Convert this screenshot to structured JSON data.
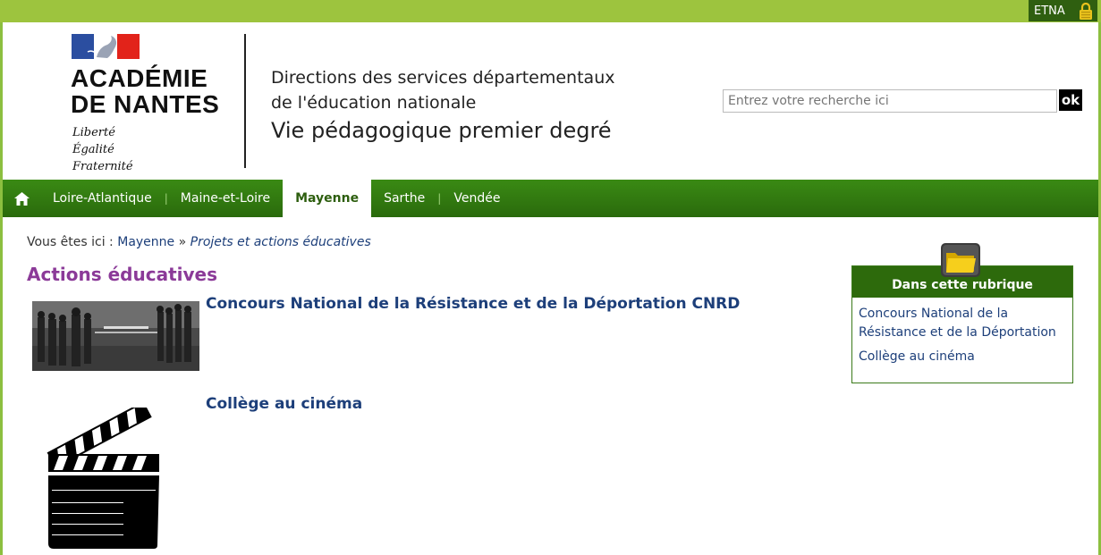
{
  "topbar": {
    "etna_label": "ETNA"
  },
  "header": {
    "logo_title_line1": "ACADÉMIE",
    "logo_title_line2": "DE NANTES",
    "motto": [
      "Liberté",
      "Égalité",
      "Fraternité"
    ],
    "dsden_line1": "Directions des services départementaux",
    "dsden_line2": "de l'éducation nationale",
    "dsden_line3": "Vie pédagogique premier degré",
    "search_placeholder": "Entrez votre recherche ici",
    "search_button": "ok"
  },
  "nav": {
    "items": [
      "Loire-Atlantique",
      "Maine-et-Loire",
      "Mayenne",
      "Sarthe",
      "Vendée"
    ],
    "active": "Mayenne"
  },
  "breadcrumb": {
    "prefix": "Vous êtes ici :",
    "link": "Mayenne",
    "separator": "»",
    "current": "Projets et actions éducatives"
  },
  "page_title": "Actions éducatives",
  "articles": [
    {
      "title": "Concours National de la Résistance et de la Déportation CNRD"
    },
    {
      "title": "Collège au cinéma"
    }
  ],
  "sidebar": {
    "heading": "Dans cette rubrique",
    "links": [
      "Concours National de la Résistance et de la Déportation",
      "Collège au cinéma"
    ]
  },
  "colors": {
    "topbar": "#9dc43e",
    "nav": "#2d6a0c",
    "title": "#8b3a98",
    "link": "#1d3f7a"
  }
}
